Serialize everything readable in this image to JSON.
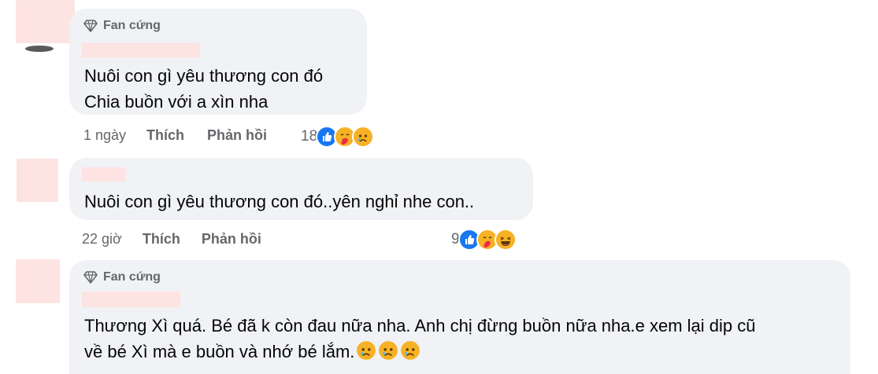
{
  "comments": [
    {
      "badge": "Fan cứng",
      "lines": [
        "Nuôi con gì yêu thương con đó",
        "Chia buồn với a xìn nha"
      ],
      "time": "1 ngày",
      "like_label": "Thích",
      "reply_label": "Phản hồi",
      "reaction_count": "18",
      "reactions": [
        "like-icon",
        "care-icon",
        "sad-icon"
      ]
    },
    {
      "lines": [
        "Nuôi con gì yêu thương con đó..yên nghỉ nhe con.."
      ],
      "time": "22 giờ",
      "like_label": "Thích",
      "reply_label": "Phản hồi",
      "reaction_count": "9",
      "reactions": [
        "like-icon",
        "care-icon",
        "haha-icon"
      ]
    },
    {
      "badge": "Fan cứng",
      "lines": [
        "Thương Xì quá. Bé đã k còn đau nữa nha. Anh chị đừng buồn nữa nha.e xem lại dip cũ",
        "về bé Xì mà e buồn và nhớ bé lắm."
      ],
      "inline_emojis": [
        "sad-icon",
        "sad-icon",
        "sad-icon"
      ]
    }
  ],
  "colors": {
    "bubble": "#f0f2f5",
    "muted": "#65676b",
    "like": "#1877f2",
    "emoji_yellow": "#f7b125",
    "redaction": "#fde3e1"
  }
}
